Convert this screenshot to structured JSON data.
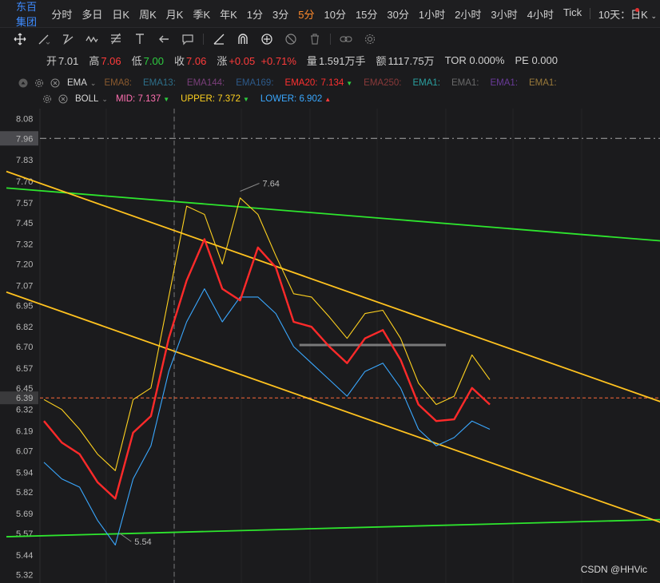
{
  "timeframe_bar": {
    "symbol": "东百集团",
    "items": [
      "分时",
      "多日",
      "日K",
      "周K",
      "月K",
      "季K",
      "年K",
      "1分",
      "3分",
      "5分",
      "10分",
      "15分",
      "30分",
      "1小时",
      "2小时",
      "3小时",
      "4小时",
      "Tick"
    ],
    "active": "5分",
    "dropdown": "10天：日K"
  },
  "quote": {
    "open_label": "开",
    "open": "7.01",
    "high_label": "高",
    "high": "7.06",
    "low_label": "低",
    "low": "7.00",
    "close_label": "收",
    "close": "7.06",
    "change_label": "涨",
    "change": "+0.05",
    "change_pct": "+0.71%",
    "volume_label": "量",
    "volume": "1.591万手",
    "amount_label": "额",
    "amount": "1117.75万",
    "tor": "TOR 0.000%",
    "pe": "PE 0.000"
  },
  "ema_legend": {
    "name": "EMA",
    "items": [
      {
        "label": "EMA8:",
        "value": "",
        "color": "#8a5a2e"
      },
      {
        "label": "EMA13:",
        "value": "",
        "color": "#2d6f8a"
      },
      {
        "label": "EMA144:",
        "value": "",
        "color": "#7a3f7a"
      },
      {
        "label": "EMA169:",
        "value": "",
        "color": "#2d5a8a"
      },
      {
        "label": "EMA20:",
        "value": "7.134",
        "color": "#ff3030",
        "arrow": "down"
      },
      {
        "label": "EMA250:",
        "value": "",
        "color": "#8a3a3a"
      },
      {
        "label": "EMA1:",
        "value": "",
        "color": "#2aa0a0"
      },
      {
        "label": "EMA1:",
        "value": "",
        "color": "#6a6a6a"
      },
      {
        "label": "EMA1:",
        "value": "",
        "color": "#6a3a9a"
      },
      {
        "label": "EMA1:",
        "value": "",
        "color": "#9a7a3a"
      }
    ]
  },
  "boll_legend": {
    "name": "BOLL",
    "mid_label": "MID:",
    "mid": "7.137",
    "mid_color": "#ff6fb0",
    "upper_label": "UPPER:",
    "upper": "7.372",
    "upper_color": "#ffd21f",
    "lower_label": "LOWER:",
    "lower": "6.902",
    "lower_color": "#3aa8ff"
  },
  "colors": {
    "up": "#ff3b3b",
    "down": "#2ecc40",
    "accent": "#ff8a2b",
    "trend_green": "#2ee62e",
    "channel_yellow": "#ffc21f",
    "ema20": "#ff2a2a",
    "boll_upper": "#ffd21f",
    "boll_lower": "#3aa8ff"
  },
  "watermark": "CSDN @HHVic",
  "chart_data": {
    "type": "line",
    "title": "",
    "ylim": [
      5.27,
      8.14
    ],
    "y_ticks": [
      8.08,
      7.96,
      7.83,
      7.7,
      7.57,
      7.45,
      7.32,
      7.2,
      7.07,
      6.95,
      6.82,
      6.7,
      6.57,
      6.45,
      6.39,
      6.32,
      6.19,
      6.07,
      5.94,
      5.82,
      5.69,
      5.57,
      5.44,
      5.32
    ],
    "highlighted_ticks": {
      "dashed_level": 7.96,
      "current_price": 6.39
    },
    "high_annotation": {
      "label": "7.64",
      "value": 7.64
    },
    "low_annotation": {
      "label": "5.54",
      "value": 5.54
    },
    "grid": false,
    "x": [
      0,
      4,
      8,
      12,
      16,
      20,
      24,
      28,
      32,
      36,
      40,
      44,
      48,
      52,
      56,
      60,
      64,
      68,
      72,
      76,
      80,
      84,
      88,
      92,
      96,
      100
    ],
    "series": [
      {
        "name": "EMA20",
        "color": "#ff2a2a",
        "values": [
          6.25,
          6.12,
          6.05,
          5.88,
          5.78,
          6.18,
          6.28,
          6.75,
          7.1,
          7.35,
          7.05,
          6.98,
          7.3,
          7.18,
          6.85,
          6.82,
          6.7,
          6.6,
          6.75,
          6.8,
          6.62,
          6.35,
          6.25,
          6.26,
          6.45,
          6.35
        ]
      },
      {
        "name": "UPPER",
        "color": "#ffd21f",
        "values": [
          6.38,
          6.32,
          6.2,
          6.05,
          5.95,
          6.38,
          6.45,
          7.0,
          7.55,
          7.5,
          7.2,
          7.6,
          7.5,
          7.25,
          7.02,
          7.0,
          6.88,
          6.75,
          6.9,
          6.92,
          6.75,
          6.48,
          6.35,
          6.4,
          6.65,
          6.5
        ]
      },
      {
        "name": "LOWER",
        "color": "#3aa8ff",
        "values": [
          6.0,
          5.9,
          5.85,
          5.65,
          5.5,
          5.9,
          6.1,
          6.55,
          6.85,
          7.05,
          6.85,
          7.0,
          7.0,
          6.9,
          6.7,
          6.6,
          6.5,
          6.4,
          6.55,
          6.6,
          6.45,
          6.2,
          6.1,
          6.15,
          6.25,
          6.2
        ]
      }
    ],
    "trendlines": [
      {
        "name": "green-upper-trend",
        "color": "#2ee62e",
        "from": [
          -10,
          7.66
        ],
        "to": [
          175,
          7.32
        ]
      },
      {
        "name": "green-lower-trend",
        "color": "#2ee62e",
        "from": [
          -10,
          5.55
        ],
        "to": [
          175,
          5.66
        ]
      },
      {
        "name": "yellow-channel-top",
        "color": "#ffc21f",
        "from": [
          -10,
          7.76
        ],
        "to": [
          175,
          6.28
        ]
      },
      {
        "name": "yellow-channel-bottom",
        "color": "#ffc21f",
        "from": [
          -10,
          7.03
        ],
        "to": [
          175,
          5.55
        ]
      },
      {
        "name": "gray-resistance",
        "color": "#7a7a7a",
        "from": [
          68,
          6.71
        ],
        "to": [
          107,
          6.71
        ]
      }
    ]
  }
}
